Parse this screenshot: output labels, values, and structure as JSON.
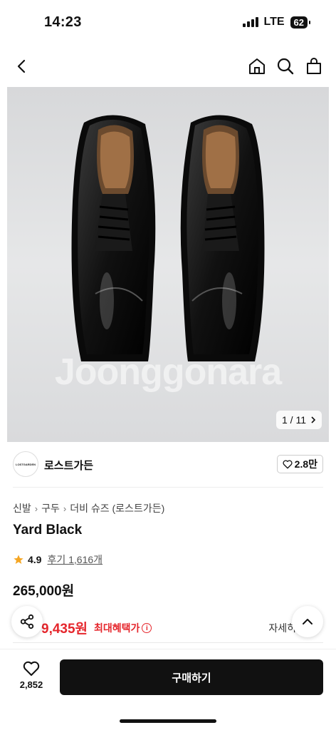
{
  "status_bar": {
    "time": "14:23",
    "network": "LTE",
    "battery": "62"
  },
  "nav": {
    "icons": [
      "back-chevron-icon",
      "home-icon",
      "search-icon",
      "shopping-bag-icon"
    ]
  },
  "product_image": {
    "watermark": "Joonggonara",
    "counter": "1 / 11"
  },
  "seller": {
    "logo_text": "LOSTGARDEN",
    "name": "로스트가든",
    "likes": "2.8만"
  },
  "breadcrumb": [
    "신발",
    "구두",
    "더비 슈즈 (로스트가든)"
  ],
  "product": {
    "title": "Yard Black",
    "rating": "4.9",
    "review_text": "후기 1,616개",
    "price": "265,000원"
  },
  "benefit": {
    "price": "9,435원",
    "label": "최대혜택가",
    "detail": "자세히"
  },
  "bottom_bar": {
    "wish_count": "2,852",
    "buy_label": "구매하기"
  },
  "colors": {
    "accent_red": "#e5262c",
    "buy_button": "#111111",
    "star": "#f5a623"
  }
}
